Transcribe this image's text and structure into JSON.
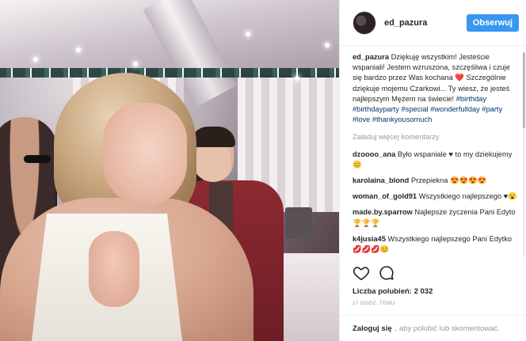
{
  "post": {
    "username": "ed_pazura",
    "follow_label": "Obserwuj",
    "caption_user": "ed_pazura",
    "caption_text": "Dziękuję wszystkim! Jesteście wspaniali! Jestem wzruszona, szczęśliwa i czuje się bardzo przez Was kochana ❤️ Szczególnie dziękuje mojemu Czarkowi... Ty wiesz, że jesteś najlepszym Mężem na świecie!",
    "caption_tags": "#birthday #birthdayparty #special #wonderfullday #party #love #thankyousomuch",
    "load_more": "Załaduj więcej komentarzy",
    "comments": [
      {
        "user": "dzoooo_ana",
        "text": "Było wspaniale ♥ to my dziekujemy 😊"
      },
      {
        "user": "karolaina_blond",
        "text": "Przepiekna 😍😍😍😍"
      },
      {
        "user": "woman_of_gold91",
        "text": "Wszystkiego najlepszego ♥😮"
      },
      {
        "user": "made.by.sparrow",
        "text": "Najlepsze życzenia Pani Edyto 🏆🏆🏆"
      },
      {
        "user": "k4jusia45",
        "text": "Wszystkiego najlepszego Pani Edytko 💋💋💋😊"
      }
    ],
    "likes": "Liczba polubień: 2 032",
    "time": "17 GODZ. TEMU",
    "login_label": "Zaloguj się",
    "login_suffix": ", aby polubić lub skomentować."
  },
  "icons": [
    "heart-icon",
    "comment-icon"
  ],
  "colors": {
    "follow": "#3897f0",
    "hashtag": "#003569",
    "muted": "#999999"
  }
}
